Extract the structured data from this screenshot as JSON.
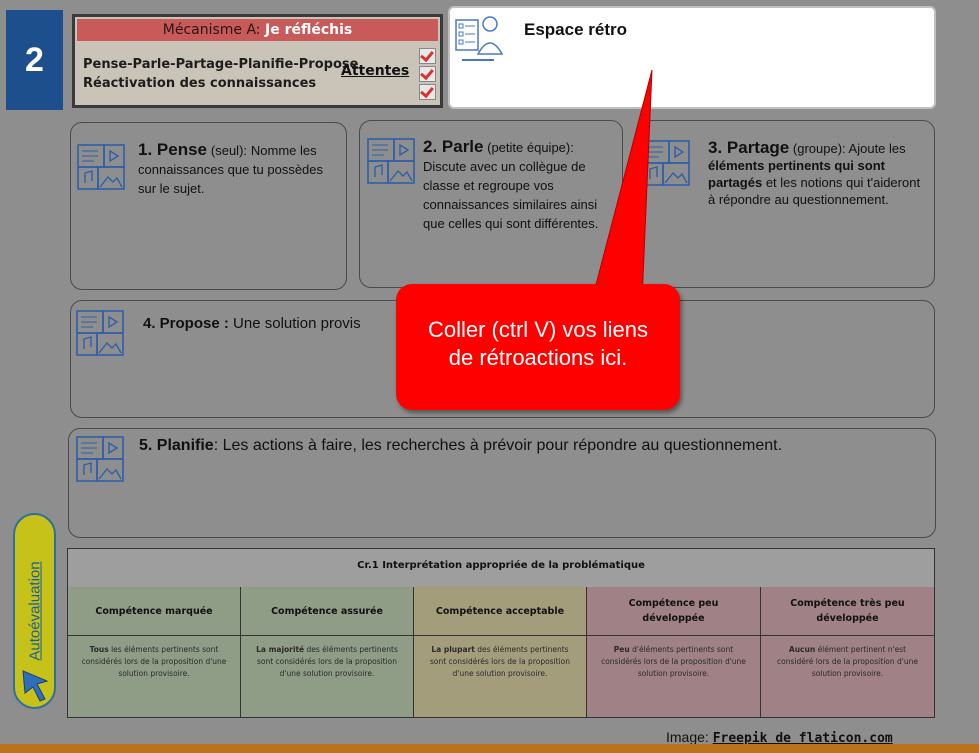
{
  "badge": {
    "number": "2"
  },
  "mechanism": {
    "title_prefix": "Mécanisme A: ",
    "title_accent": "Je réfléchis",
    "line1": "Pense-Parle-Partage-Planifie-Propose",
    "line2": "Réactivation des connaissances",
    "attentes_label": "Attentes"
  },
  "retro": {
    "title": "Espace rétro"
  },
  "steps": {
    "pense": {
      "title": "1. Pense",
      "qualifier": "(seul):",
      "text": "Nomme les connaissances que tu possèdes sur le sujet."
    },
    "parle": {
      "title": "2. Parle",
      "qualifier": "(petite équipe):",
      "text": "Discute avec un collègue de classe et regroupe vos connaissances similaires ainsi que celles qui sont différentes."
    },
    "partage": {
      "title": "3. Partage",
      "qualifier": "(groupe):",
      "text_a": "Ajoute les ",
      "text_bold": "éléments pertinents qui sont partagés",
      "text_b": " et les notions qui t'aideront à répondre au questionnement."
    },
    "propose": {
      "title": "4. Propose",
      "separator": " : ",
      "text": "Une solution provis"
    },
    "planifie": {
      "title": "5. Planifie",
      "separator": ":",
      "text": " Les actions à faire, les recherches à prévoir pour répondre au  questionnement."
    }
  },
  "callout": {
    "line1": "Coller (ctrl V) vos liens",
    "line2": "de rétroactions ici."
  },
  "autoevaluation": {
    "label": "Autoévaluation"
  },
  "rubric": {
    "header": "Cr.1 Interprétation appropriée de la problématique",
    "columns": [
      {
        "title": "Compétence marquée",
        "bold": "Tous",
        "text": " les éléments pertinents sont considérés lors de la proposition d'une solution provisoire.",
        "color": "#8f9c86"
      },
      {
        "title": "Compétence assurée",
        "bold": "La majorité",
        "text": " des éléments pertinents sont considérés lors de la proposition d'une solution provisoire.",
        "color": "#8f9c86"
      },
      {
        "title": "Compétence acceptable",
        "bold": "La plupart",
        "text": " des éléments pertinents sont considérés lors de la proposition d'une solution provisoire.",
        "color": "#a49d7c"
      },
      {
        "title": "Compétence peu développée",
        "bold": "Peu",
        "text": " d'éléments pertinents sont considérés lors de la proposition d'une solution provisoire.",
        "color": "#a08185"
      },
      {
        "title": "Compétence très peu développée",
        "bold": "Aucun",
        "text": " élément pertinent n'est considéré lors de la proposition d'une solution provisoire.",
        "color": "#a08185"
      }
    ]
  },
  "credit": {
    "prefix": "Image: ",
    "link": "Freepik de flaticon.com"
  },
  "colors": {
    "accent_red": "#ff0000",
    "badge_blue": "#1d4f8c",
    "pill_yellow": "#c7c21a",
    "bottom_bar": "#b8741c"
  },
  "icons": [
    "multimedia-icon",
    "teacher-checklist-icon",
    "checkbox-icon",
    "cursor-arrow-icon"
  ]
}
